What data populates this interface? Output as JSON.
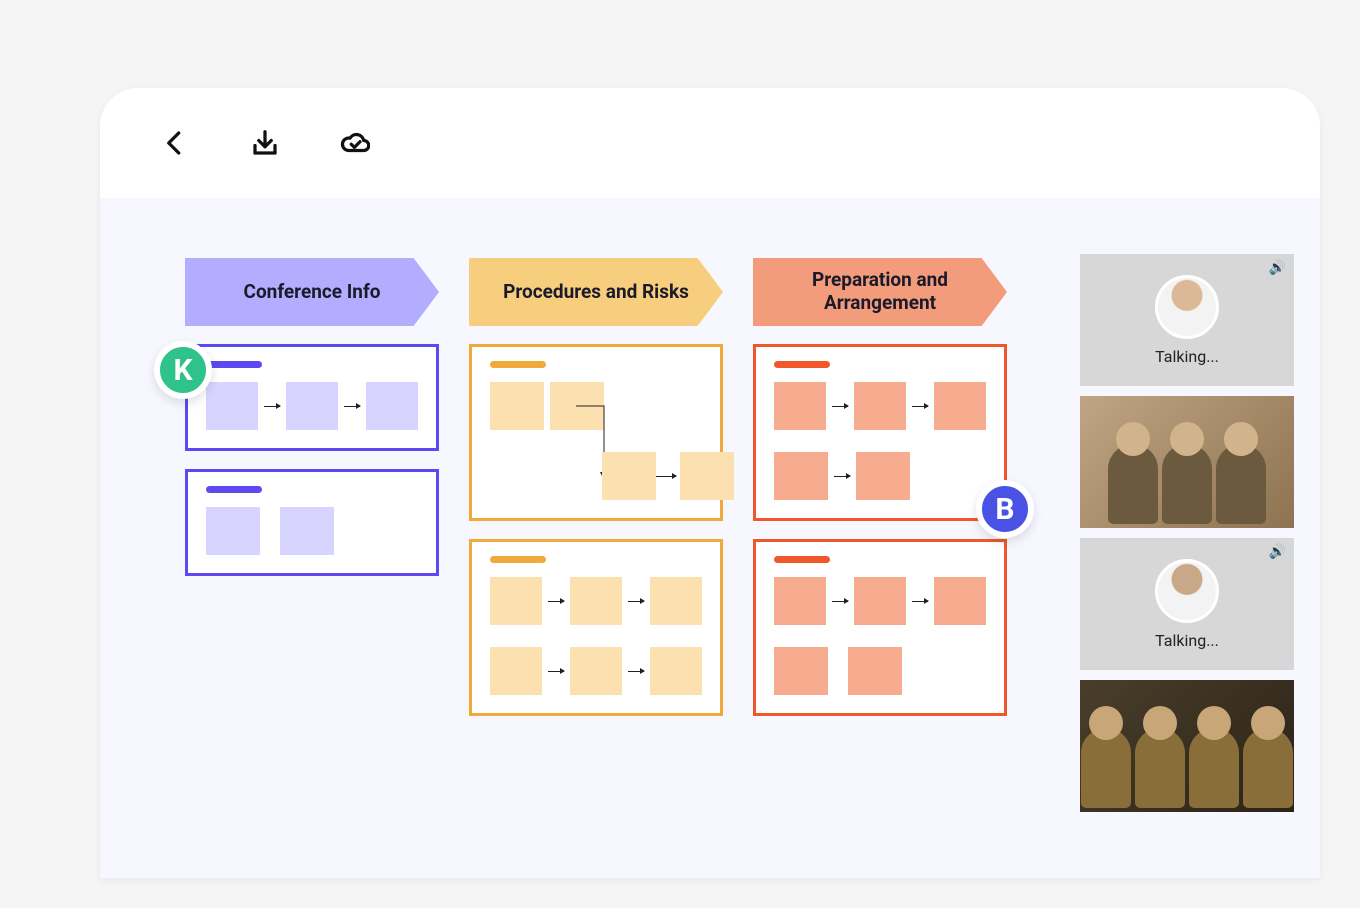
{
  "toolbar": {
    "back_label": "Back",
    "download_label": "Download",
    "sync_label": "Sync"
  },
  "columns": [
    {
      "title": "Conference Info"
    },
    {
      "title": "Procedures and Risks"
    },
    {
      "title": "Preparation and Arrangement"
    }
  ],
  "badges": {
    "k": "K",
    "b": "B"
  },
  "video": {
    "tiles": [
      {
        "type": "talking",
        "label": "Talking..."
      },
      {
        "type": "photo"
      },
      {
        "type": "talking",
        "label": "Talking..."
      },
      {
        "type": "photo"
      }
    ]
  }
}
